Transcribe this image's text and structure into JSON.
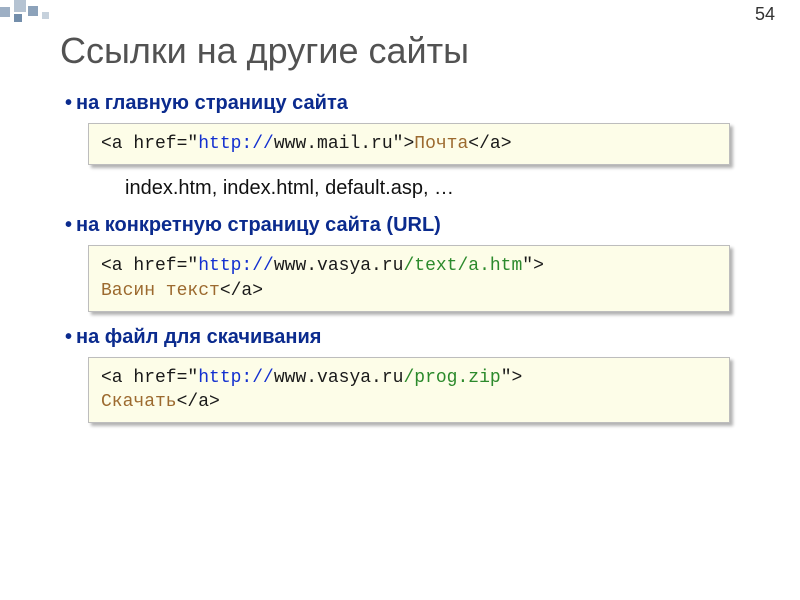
{
  "page_number": "54",
  "title": "Ссылки на другие сайты",
  "sections": [
    {
      "bullet": "на главную страницу сайта",
      "code": {
        "pre1": "<a href=\"",
        "proto": "http://",
        "rest1": "www.mail.ru\">",
        "link_text": "Почта",
        "suffix": "</a>"
      },
      "note": "index.htm, index.html, default.asp, …"
    },
    {
      "bullet": "на конкретную страницу сайта (URL)",
      "code": {
        "pre1": "<a href=\"",
        "proto": "http://",
        "host": "www.vasya.ru",
        "path": "/text/a.htm",
        "close_attr": "\">",
        "link_text": "Васин текст",
        "suffix": "</a>"
      }
    },
    {
      "bullet": "на файл для скачивания",
      "code": {
        "pre1": "<a href=\"",
        "proto": "http://",
        "host": "www.vasya.ru",
        "path": "/prog.zip",
        "close_attr": "\">",
        "link_text": "Скачать",
        "suffix": "</a>"
      }
    }
  ]
}
